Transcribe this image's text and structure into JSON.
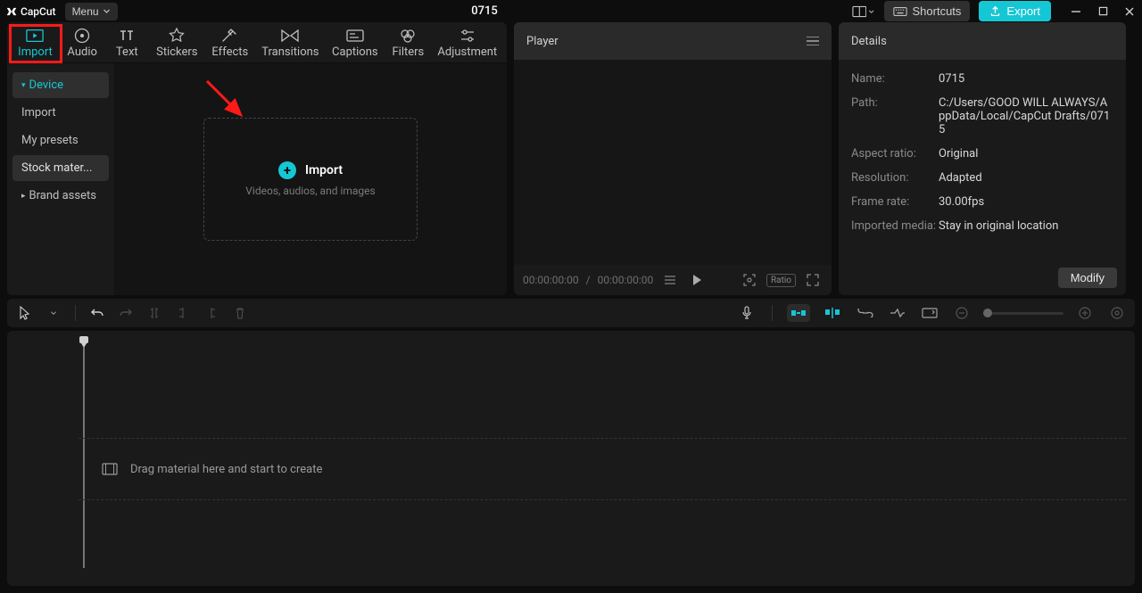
{
  "app": {
    "name": "CapCut",
    "menu": "Menu",
    "title": "0715"
  },
  "titlebar": {
    "shortcuts": "Shortcuts",
    "export": "Export"
  },
  "tabs": [
    "Import",
    "Audio",
    "Text",
    "Stickers",
    "Effects",
    "Transitions",
    "Captions",
    "Filters",
    "Adjustment"
  ],
  "sidebar": {
    "items": [
      "Device",
      "Import",
      "My presets",
      "Stock mater...",
      "Brand assets"
    ]
  },
  "dropzone": {
    "title": "Import",
    "sub": "Videos, audios, and images"
  },
  "player": {
    "title": "Player",
    "time_current": "00:00:00:00",
    "time_total": "00:00:00:00"
  },
  "details": {
    "title": "Details",
    "rows": [
      {
        "label": "Name:",
        "value": "0715"
      },
      {
        "label": "Path:",
        "value": "C:/Users/GOOD WILL ALWAYS/AppData/Local/CapCut Drafts/0715"
      },
      {
        "label": "Aspect ratio:",
        "value": "Original"
      },
      {
        "label": "Resolution:",
        "value": "Adapted"
      },
      {
        "label": "Frame rate:",
        "value": "30.00fps"
      },
      {
        "label": "Imported media:",
        "value": "Stay in original location"
      }
    ],
    "modify": "Modify"
  },
  "timeline": {
    "hint": "Drag material here and start to create"
  },
  "ratio": "Ratio"
}
